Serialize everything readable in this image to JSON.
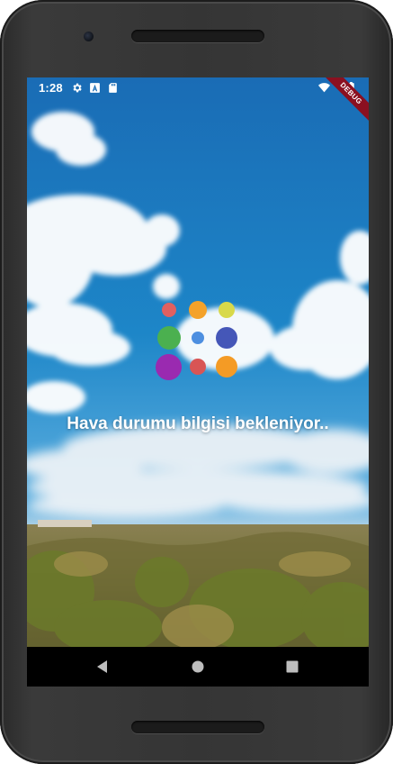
{
  "status_bar": {
    "time": "1:28",
    "icons": [
      "settings-gear-icon",
      "text-a-icon",
      "sd-card-icon",
      "wifi-icon",
      "battery-icon"
    ]
  },
  "debug_banner": "DEBUG",
  "loader": {
    "dots": [
      {
        "color": "#e06060"
      },
      {
        "color": "#f4a22a"
      },
      {
        "color": "#d8d94a"
      },
      {
        "color": "#4bb04f"
      },
      {
        "color": "#4d8fe0"
      },
      {
        "color": "#4557b8"
      },
      {
        "color": "#9a2ab0"
      },
      {
        "color": "#d85555"
      },
      {
        "color": "#f49b25"
      }
    ]
  },
  "message": "Hava durumu bilgisi bekleniyor..",
  "nav_bar": {
    "buttons": [
      "back-triangle-icon",
      "home-circle-icon",
      "recents-square-icon"
    ]
  },
  "colors": {
    "sky_top": "#1a6fb8",
    "sky_bottom": "#5fb0e6",
    "nav_bar": "#000000",
    "debug_ribbon": "#8b1020"
  }
}
